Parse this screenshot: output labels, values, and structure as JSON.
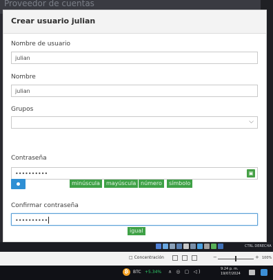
{
  "background": {
    "page_title": "Proveedor de cuentas"
  },
  "modal": {
    "title": "Crear usuario julian",
    "username": {
      "label": "Nombre de usuario",
      "value": "julian"
    },
    "name": {
      "label": "Nombre",
      "value": "julian"
    },
    "groups": {
      "label": "Grupos",
      "value": ""
    },
    "password": {
      "label": "Contraseña",
      "value": "••••••••••"
    },
    "password_rules": [
      "minúscula",
      "mayúscula",
      "número",
      "símbolo"
    ],
    "confirm_password": {
      "label": "Confirmar contraseña",
      "value": "••••••••••"
    },
    "match_badge": "igual"
  },
  "taskbar_top": {
    "keyboard_label": "CTRL DERECHA"
  },
  "statusbar": {
    "focus": "Concentración",
    "zoom_minus": "−",
    "zoom_plus": "+",
    "zoom": "100%",
    "zoom_level": 0.5
  },
  "taskbar_bottom": {
    "ticker": "BTC",
    "ticker_change": "+5.34%",
    "time": "9:24 p. m.",
    "date": "19/07/2024"
  },
  "icons": {
    "lock": "lock-icon",
    "eye": "eye-icon",
    "chevron": "chevron-down-icon",
    "bitcoin": "bitcoin-icon"
  },
  "colors": {
    "badge_green": "#3ea146",
    "primary_blue": "#2e8fd4",
    "focus_border": "#5a9fd6"
  }
}
